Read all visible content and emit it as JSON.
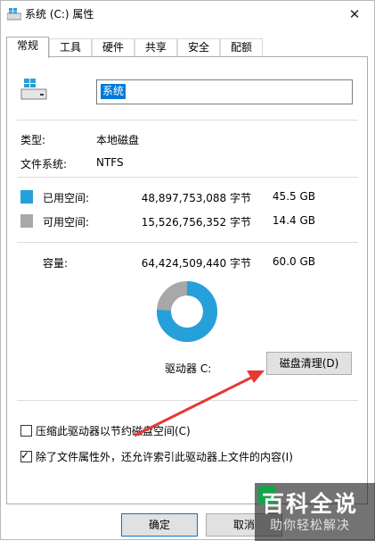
{
  "window": {
    "title": "系统 (C:) 属性",
    "close_glyph": "✕"
  },
  "tabs": [
    {
      "label": "常规",
      "active": true
    },
    {
      "label": "工具",
      "active": false
    },
    {
      "label": "硬件",
      "active": false
    },
    {
      "label": "共享",
      "active": false
    },
    {
      "label": "安全",
      "active": false
    },
    {
      "label": "配额",
      "active": false
    }
  ],
  "general": {
    "drive_name": "系统",
    "type_label": "类型:",
    "type_value": "本地磁盘",
    "fs_label": "文件系统:",
    "fs_value": "NTFS",
    "used_label": "已用空间:",
    "used_bytes": "48,897,753,088 字节",
    "used_gb": "45.5 GB",
    "free_label": "可用空间:",
    "free_bytes": "15,526,756,352 字节",
    "free_gb": "14.4 GB",
    "capacity_label": "容量:",
    "capacity_bytes": "64,424,509,440 字节",
    "capacity_gb": "60.0 GB",
    "drive_label": "驱动器 C:",
    "cleanup_button": "磁盘清理(D)",
    "compress_label": "压缩此驱动器以节约磁盘空间(C)",
    "compress_checked": false,
    "index_label": "除了文件属性外，还允许索引此驱动器上文件的内容(I)",
    "index_checked": true
  },
  "usage": {
    "used_fraction": 0.759,
    "used_color": "#26a0da",
    "free_color": "#a8a8a8"
  },
  "footer": {
    "ok_button": "确定",
    "cancel_button": "取消"
  },
  "watermark": {
    "title": "百科全说",
    "subtitle": "助你轻松解决"
  }
}
